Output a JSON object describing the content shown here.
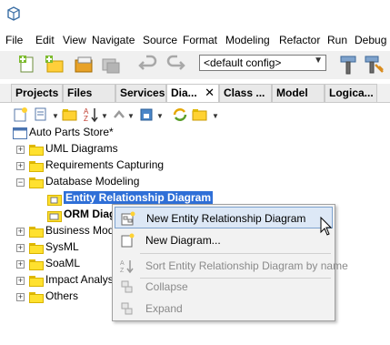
{
  "menubar": {
    "items": [
      "File",
      "Edit",
      "View",
      "Navigate",
      "Source",
      "Format",
      "Modeling",
      "Refactor",
      "Run",
      "Debug"
    ]
  },
  "toolbar": {
    "config_value": "<default config>"
  },
  "tabs": {
    "items": [
      "Projects",
      "Files",
      "Services",
      "Dia...",
      "Class ...",
      "Model",
      "Logica..."
    ],
    "close_glyph": "✕"
  },
  "tree": {
    "root": "Auto Parts Store*",
    "nodes": {
      "uml": "UML Diagrams",
      "req": "Requirements Capturing",
      "db": "Database Modeling",
      "erd": "Entity Relationship Diagram",
      "orm": "ORM Diag",
      "biz": "Business Model",
      "sysml": "SysML",
      "soaml": "SoaML",
      "impact": "Impact Analysis",
      "others": "Others"
    }
  },
  "context_menu": {
    "new_erd": "New Entity Relationship Diagram",
    "new_diagram": "New Diagram...",
    "sort": "Sort Entity Relationship Diagram by name",
    "collapse": "Collapse",
    "expand": "Expand"
  },
  "colors": {
    "selection": "#2f6fd7",
    "folder": "#ffe12f",
    "menu_hover": "#dde8f6"
  }
}
